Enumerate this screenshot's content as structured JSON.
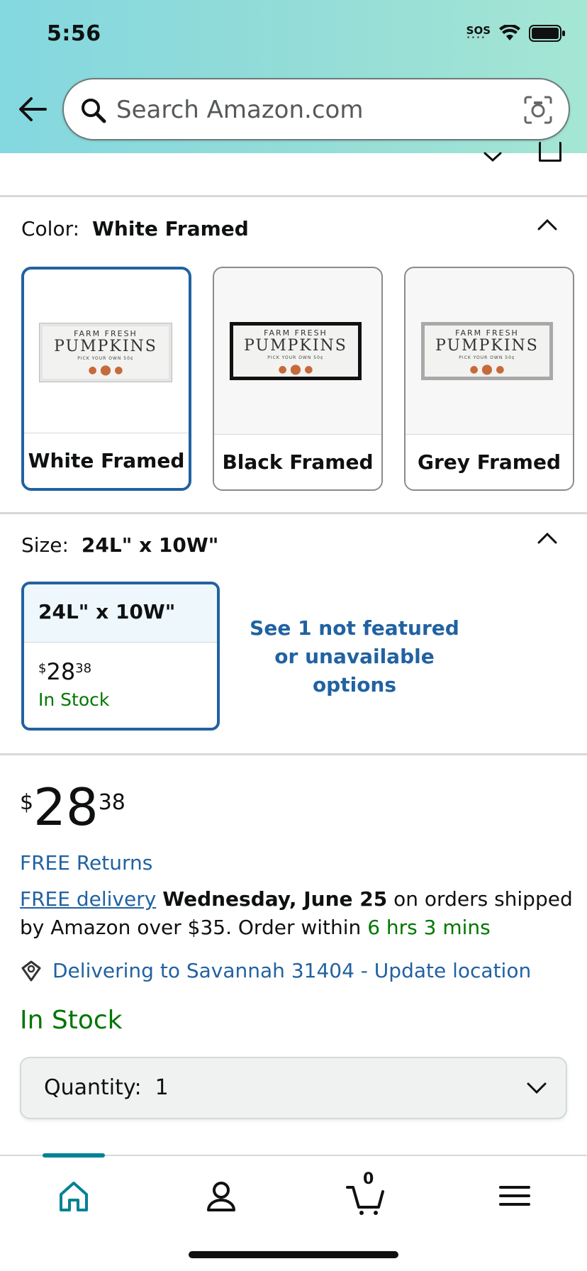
{
  "status_bar": {
    "time": "5:56",
    "sos": "SOS"
  },
  "search": {
    "placeholder": "Search Amazon.com"
  },
  "color": {
    "label": "Color:",
    "selected": "White Framed",
    "options": [
      {
        "label": "White Framed",
        "frame_color": "#e4e4e4"
      },
      {
        "label": "Black Framed",
        "frame_color": "#111111"
      },
      {
        "label": "Grey Framed",
        "frame_color": "#a9a9a9"
      }
    ]
  },
  "product_image": {
    "line1": "FARM FRESH",
    "line2": "PUMPKINS",
    "line3": "PICK YOUR OWN     50¢"
  },
  "size": {
    "label": "Size:",
    "selected": "24L\" x 10W\"",
    "option": {
      "label": "24L\" x 10W\"",
      "price_currency": "$",
      "price_whole": "28",
      "price_fraction": "38",
      "stock": "In Stock"
    },
    "see_more": "See 1 not featured or unavailable options"
  },
  "price": {
    "currency": "$",
    "whole": "28",
    "fraction": "38"
  },
  "free_returns": "FREE Returns",
  "delivery": {
    "link": "FREE delivery",
    "date": "Wednesday, June 25",
    "text1": " on orders shipped by Amazon over $35. Order within ",
    "countdown": "6 hrs 3 mins"
  },
  "location": "Delivering to Savannah 31404 - Update location",
  "stock_status": "In Stock",
  "quantity": {
    "label": "Quantity:",
    "value": "1"
  },
  "cart": {
    "count": "0"
  },
  "colors": {
    "link": "#2162a1",
    "green": "#007600",
    "accent": "#008296"
  }
}
